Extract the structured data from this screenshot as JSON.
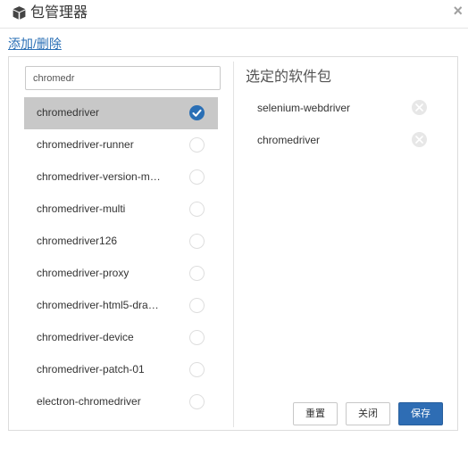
{
  "dialog": {
    "title": "包管理器",
    "close_icon": "close-icon",
    "package_icon": "package-icon"
  },
  "link": {
    "add_remove": "添加/删除"
  },
  "search": {
    "value": "chromedr"
  },
  "results": [
    {
      "label": "chromedriver",
      "checked": true
    },
    {
      "label": "chromedriver-runner",
      "checked": false
    },
    {
      "label": "chromedriver-version-m…",
      "checked": false
    },
    {
      "label": "chromedriver-multi",
      "checked": false
    },
    {
      "label": "chromedriver126",
      "checked": false
    },
    {
      "label": "chromedriver-proxy",
      "checked": false
    },
    {
      "label": "chromedriver-html5-dra…",
      "checked": false
    },
    {
      "label": "chromedriver-device",
      "checked": false
    },
    {
      "label": "chromedriver-patch-01",
      "checked": false
    },
    {
      "label": "electron-chromedriver",
      "checked": false
    }
  ],
  "selected_panel": {
    "title": "选定的软件包",
    "items": [
      {
        "label": "selenium-webdriver"
      },
      {
        "label": "chromedriver"
      }
    ]
  },
  "buttons": {
    "reset": "重置",
    "close": "关闭",
    "save": "保存"
  },
  "colors": {
    "primary": "#2e6db4",
    "link": "#2a6fb5",
    "selected_row": "#c8c8c8"
  }
}
